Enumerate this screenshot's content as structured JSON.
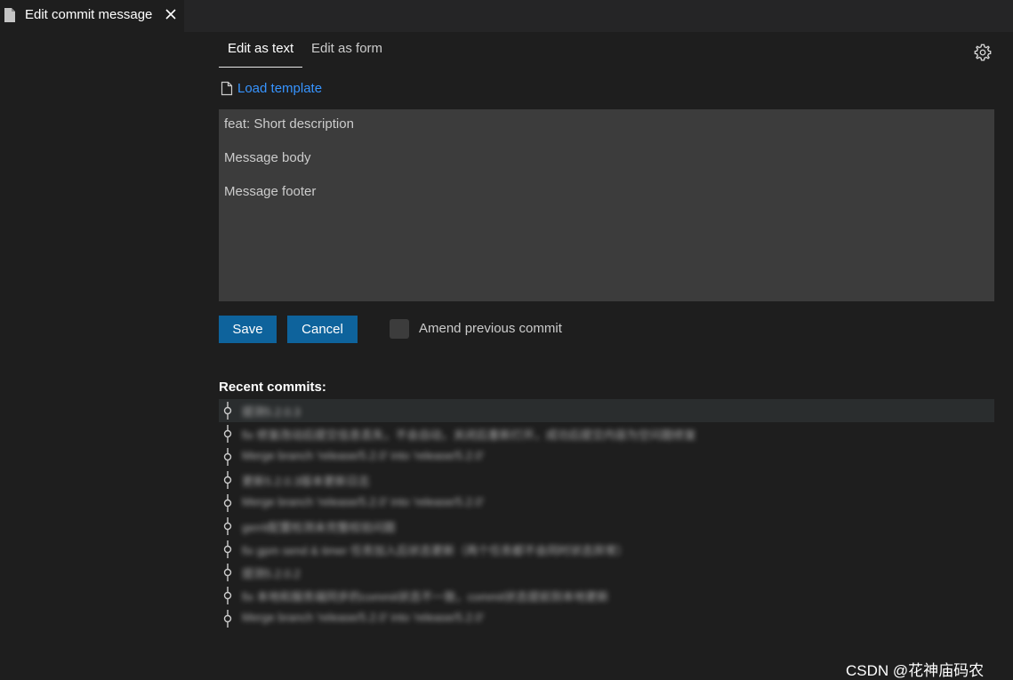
{
  "tab": {
    "title": "Edit commit message",
    "icon": "file-icon",
    "close_icon": "close-icon"
  },
  "view_tabs": [
    {
      "label": "Edit as text",
      "active": true
    },
    {
      "label": "Edit as form",
      "active": false
    }
  ],
  "settings_icon": "gear-icon",
  "load_template": {
    "label": "Load template",
    "icon": "file-icon"
  },
  "message": {
    "lines": [
      "feat: Short description",
      "Message body",
      "Message footer"
    ]
  },
  "buttons": {
    "save_label": "Save",
    "cancel_label": "Cancel"
  },
  "amend": {
    "label": "Amend previous commit",
    "checked": false
  },
  "recent_commits": {
    "heading": "Recent commits:",
    "items": [
      "提测5.2.0.3",
      "fix 修复改动后提交信息丢失，不会自动，关闭后重新打开，成功后提交内容为空问题修复",
      "Merge branch 'release/5.2.0' into 'release/5.2.0'",
      "更新5.2.0.3版本更新日志",
      "Merge branch 'release/5.2.0' into 'release/5.2.0'",
      "gerrit配置检测未完整校验问题",
      "fix gpm send & timer 任务加入后状态更新（两个任务都不会同时状态异常）",
      "提测5.2.0.2",
      "fix 本地和服务端同步的commit状态不一致，commit状态提前到本地更新",
      "Merge branch 'release/5.2.0' into 'release/5.2.0'"
    ]
  },
  "watermark": "CSDN @花神庙码农",
  "colors": {
    "background": "#1e1e1e",
    "tabbar": "#252526",
    "input_background": "#3c3c3c",
    "button": "#0e639c",
    "link": "#3794ff"
  }
}
